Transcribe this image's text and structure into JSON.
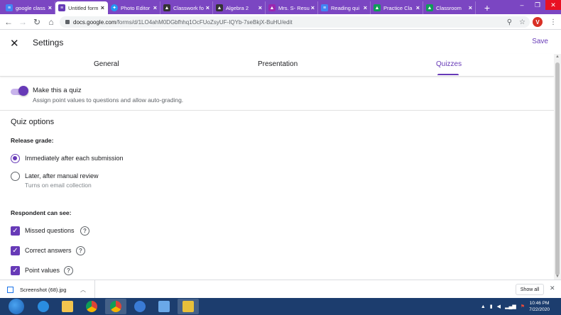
{
  "browser": {
    "tabs": [
      {
        "title": "google class",
        "icon_color": "#4285f4",
        "active": false
      },
      {
        "title": "Untitled form",
        "icon_color": "#673ab7",
        "active": true
      },
      {
        "title": "Photo Editor",
        "icon_color": "#2196f3",
        "active": false
      },
      {
        "title": "Classwork fo",
        "icon_color": "#333333",
        "active": false
      },
      {
        "title": "Algebra 2",
        "icon_color": "#333333",
        "active": false
      },
      {
        "title": "Mrs. S- Resu",
        "icon_color": "#9c27b0",
        "active": false
      },
      {
        "title": "Reading qui",
        "icon_color": "#4285f4",
        "active": false
      },
      {
        "title": "Practice Cla",
        "icon_color": "#0f9d58",
        "active": false
      },
      {
        "title": "Classroom",
        "icon_color": "#0f9d58",
        "active": false
      }
    ],
    "new_tab": "+",
    "url_host": "docs.google.com",
    "url_path": "/forms/d/1LO4ahM0DGbfhhq1OcFUoZsyUF-IQYb-7seBkjX-BuHU/edit",
    "profile_initial": "V"
  },
  "settings": {
    "title": "Settings",
    "save_label": "Save",
    "tabs": [
      "General",
      "Presentation",
      "Quizzes"
    ],
    "active_tab": "Quizzes",
    "make_quiz": {
      "label": "Make this a quiz",
      "description": "Assign point values to questions and allow auto-grading.",
      "enabled": true
    },
    "quiz_options_title": "Quiz options",
    "release_grade": {
      "heading": "Release grade:",
      "options": [
        {
          "label": "Immediately after each submission",
          "description": "",
          "selected": true
        },
        {
          "label": "Later, after manual review",
          "description": "Turns on email collection",
          "selected": false
        }
      ]
    },
    "respondent_can_see": {
      "heading": "Respondent can see:",
      "items": [
        {
          "label": "Missed questions",
          "checked": true
        },
        {
          "label": "Correct answers",
          "checked": true
        },
        {
          "label": "Point values",
          "checked": true
        }
      ]
    }
  },
  "downloads": {
    "file_name": "Screenshot (68).jpg",
    "show_all_label": "Show all"
  },
  "taskbar": {
    "time": "10:46 PM",
    "date": "7/22/2020"
  },
  "colors": {
    "accent": "#673ab7",
    "chrome_tabstrip": "#7b46c2",
    "taskbar": "#1c3d6e"
  }
}
